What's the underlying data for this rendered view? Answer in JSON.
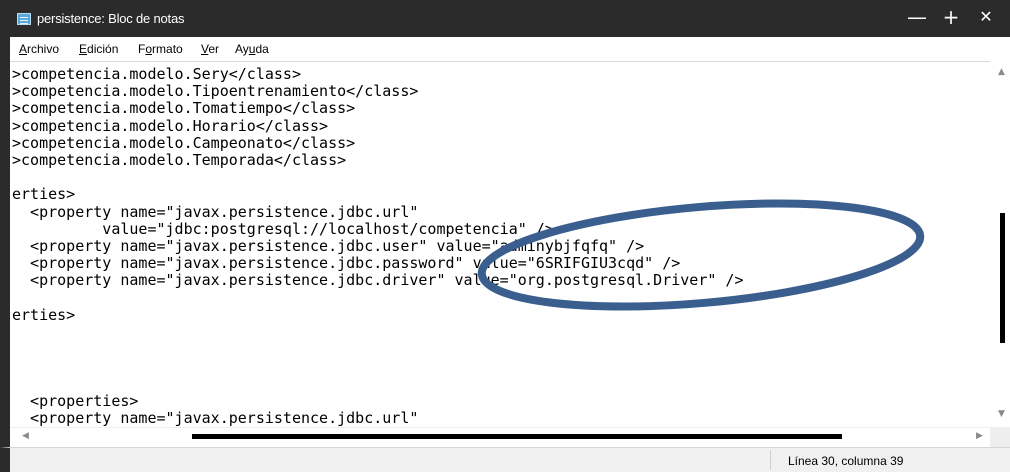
{
  "window": {
    "title": "persistence: Bloc de notas",
    "minimize_glyph": "—",
    "maximize_glyph": "+",
    "close_glyph": "✕"
  },
  "menu": [
    {
      "label": "Archivo",
      "mnemonic": "A",
      "rest": "rchivo"
    },
    {
      "label": "Edición",
      "mnemonic": "E",
      "rest": "dición"
    },
    {
      "label": "Formato",
      "mnemonic": "o",
      "pre": "F",
      "rest": "rmato"
    },
    {
      "label": "Ver",
      "mnemonic": "V",
      "rest": "er"
    },
    {
      "label": "Ayuda",
      "mnemonic": "u",
      "pre": "Ay",
      "rest": "da"
    }
  ],
  "editor": {
    "lines": [
      ">competencia.modelo.Sery</class>",
      ">competencia.modelo.Tipoentrenamiento</class>",
      ">competencia.modelo.Tomatiempo</class>",
      ">competencia.modelo.Horario</class>",
      ">competencia.modelo.Campeonato</class>",
      ">competencia.modelo.Temporada</class>",
      "",
      "erties>",
      "  <property name=\"javax.persistence.jdbc.url\"",
      "          value=\"jdbc:postgresql://localhost/competencia\" />",
      "  <property name=\"javax.persistence.jdbc.user\" value=\"adminybjfqfq\" />",
      "  <property name=\"javax.persistence.jdbc.password\" value=\"6SRIFGIU3cqd\" />",
      "  <property name=\"javax.persistence.jdbc.driver\" value=\"org.postgresql.Driver\" />",
      "",
      "erties>",
      "",
      "",
      "",
      "",
      "  <properties>",
      "  <property name=\"javax.persistence.jdbc.url\""
    ]
  },
  "status": {
    "position": "Línea 30, columna 39"
  },
  "colors": {
    "titlebar": "#2b2b2b",
    "annotation_ellipse": "#3a5f8f"
  },
  "icons": {
    "app": "notepad-icon",
    "scroll_up": "arrow-up-icon",
    "scroll_down": "arrow-down-icon",
    "scroll_left": "arrow-left-icon",
    "scroll_right": "arrow-right-icon"
  }
}
